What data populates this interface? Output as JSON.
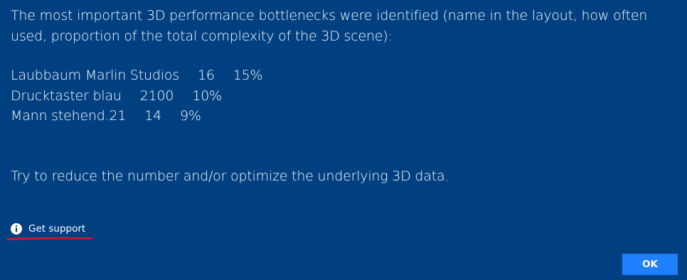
{
  "dialog": {
    "intro_text": "The most important 3D performance bottlenecks were identified (name in the layout, how often used, proportion of the total complexity of the 3D scene):",
    "bottlenecks": [
      {
        "name": "Laubbaum Marlin Studios",
        "count": "16",
        "proportion": "15%"
      },
      {
        "name": "Drucktaster blau",
        "count": "2100",
        "proportion": "10%"
      },
      {
        "name": "Mann stehend.21",
        "count": "14",
        "proportion": "9%"
      }
    ],
    "advice_text": "Try to reduce the number and/or optimize the underlying 3D data.",
    "support_label": "Get support",
    "support_icon": "info-icon",
    "ok_label": "OK"
  },
  "colors": {
    "background": "#004080",
    "ok_button": "#1e7fff",
    "annotation_underline": "#d0142c",
    "text": "#ffffff"
  }
}
